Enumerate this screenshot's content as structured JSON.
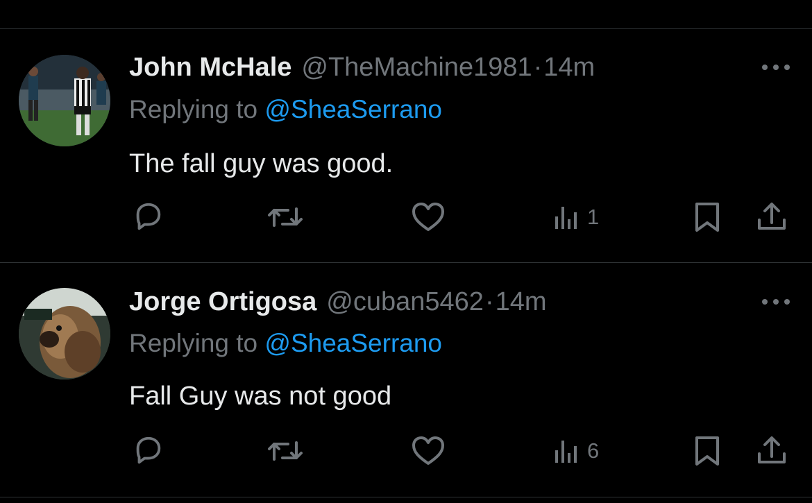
{
  "tweets": [
    {
      "name": "John McHale",
      "handle": "@TheMachine1981",
      "separator": "·",
      "time": "14m",
      "replying_prefix": "Replying to ",
      "replying_to": "@SheaSerrano",
      "text": "The fall guy was good.",
      "views": "1",
      "avatar": "soccer-players-photo"
    },
    {
      "name": "Jorge Ortigosa",
      "handle": "@cuban5462",
      "separator": "·",
      "time": "14m",
      "replying_prefix": "Replying to ",
      "replying_to": "@SheaSerrano",
      "text": "Fall Guy was not good",
      "views": "6",
      "avatar": "dog-photo"
    }
  ],
  "icons": {
    "reply": "reply-icon",
    "retweet": "retweet-icon",
    "like": "like-icon",
    "views": "views-icon",
    "bookmark": "bookmark-icon",
    "share": "share-icon",
    "more": "more-icon"
  },
  "colors": {
    "background": "#000000",
    "text": "#e7e9ea",
    "muted": "#71767b",
    "link": "#1d9bf0",
    "divider": "#2f3336"
  }
}
